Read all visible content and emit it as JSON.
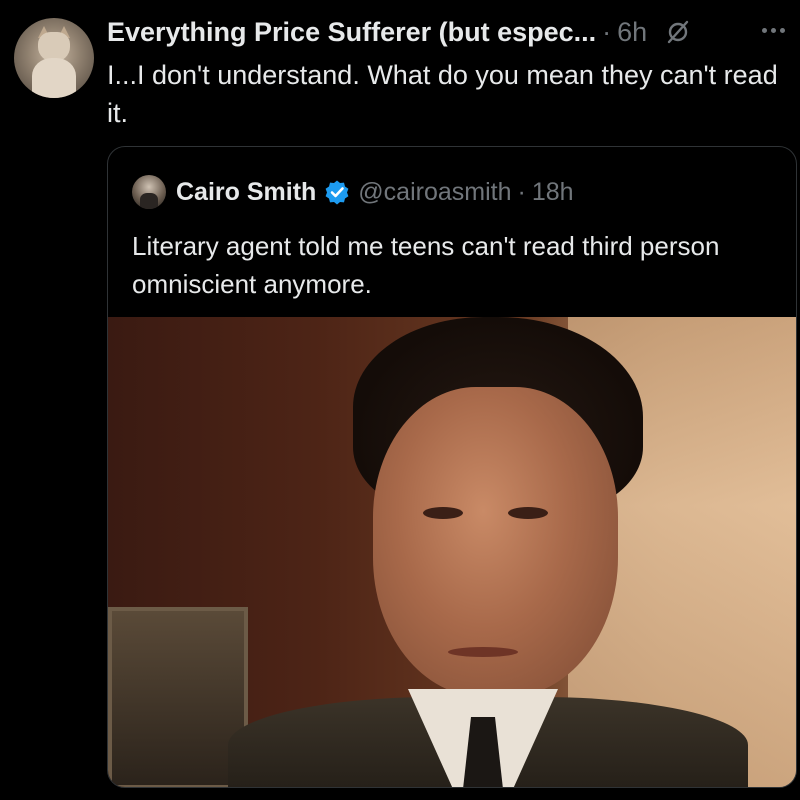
{
  "post": {
    "author": "Everything Price Sufferer (but espec...",
    "separator": "·",
    "time": "6h",
    "text": "I...I don't understand. What do you mean they can't read it."
  },
  "quote": {
    "name": "Cairo Smith",
    "handle": "@cairoasmith",
    "separator": "·",
    "time": "18h",
    "text": "Literary agent told me teens can't read third person omniscient anymore."
  },
  "icons": {
    "more": "more-horizontal-icon",
    "edit_disabled": "slash-icon",
    "verified": "verified-badge-icon"
  },
  "colors": {
    "background": "#000000",
    "text": "#e7e9ea",
    "muted": "#71767b",
    "verified": "#1d9bf0",
    "border": "#2f3336"
  }
}
